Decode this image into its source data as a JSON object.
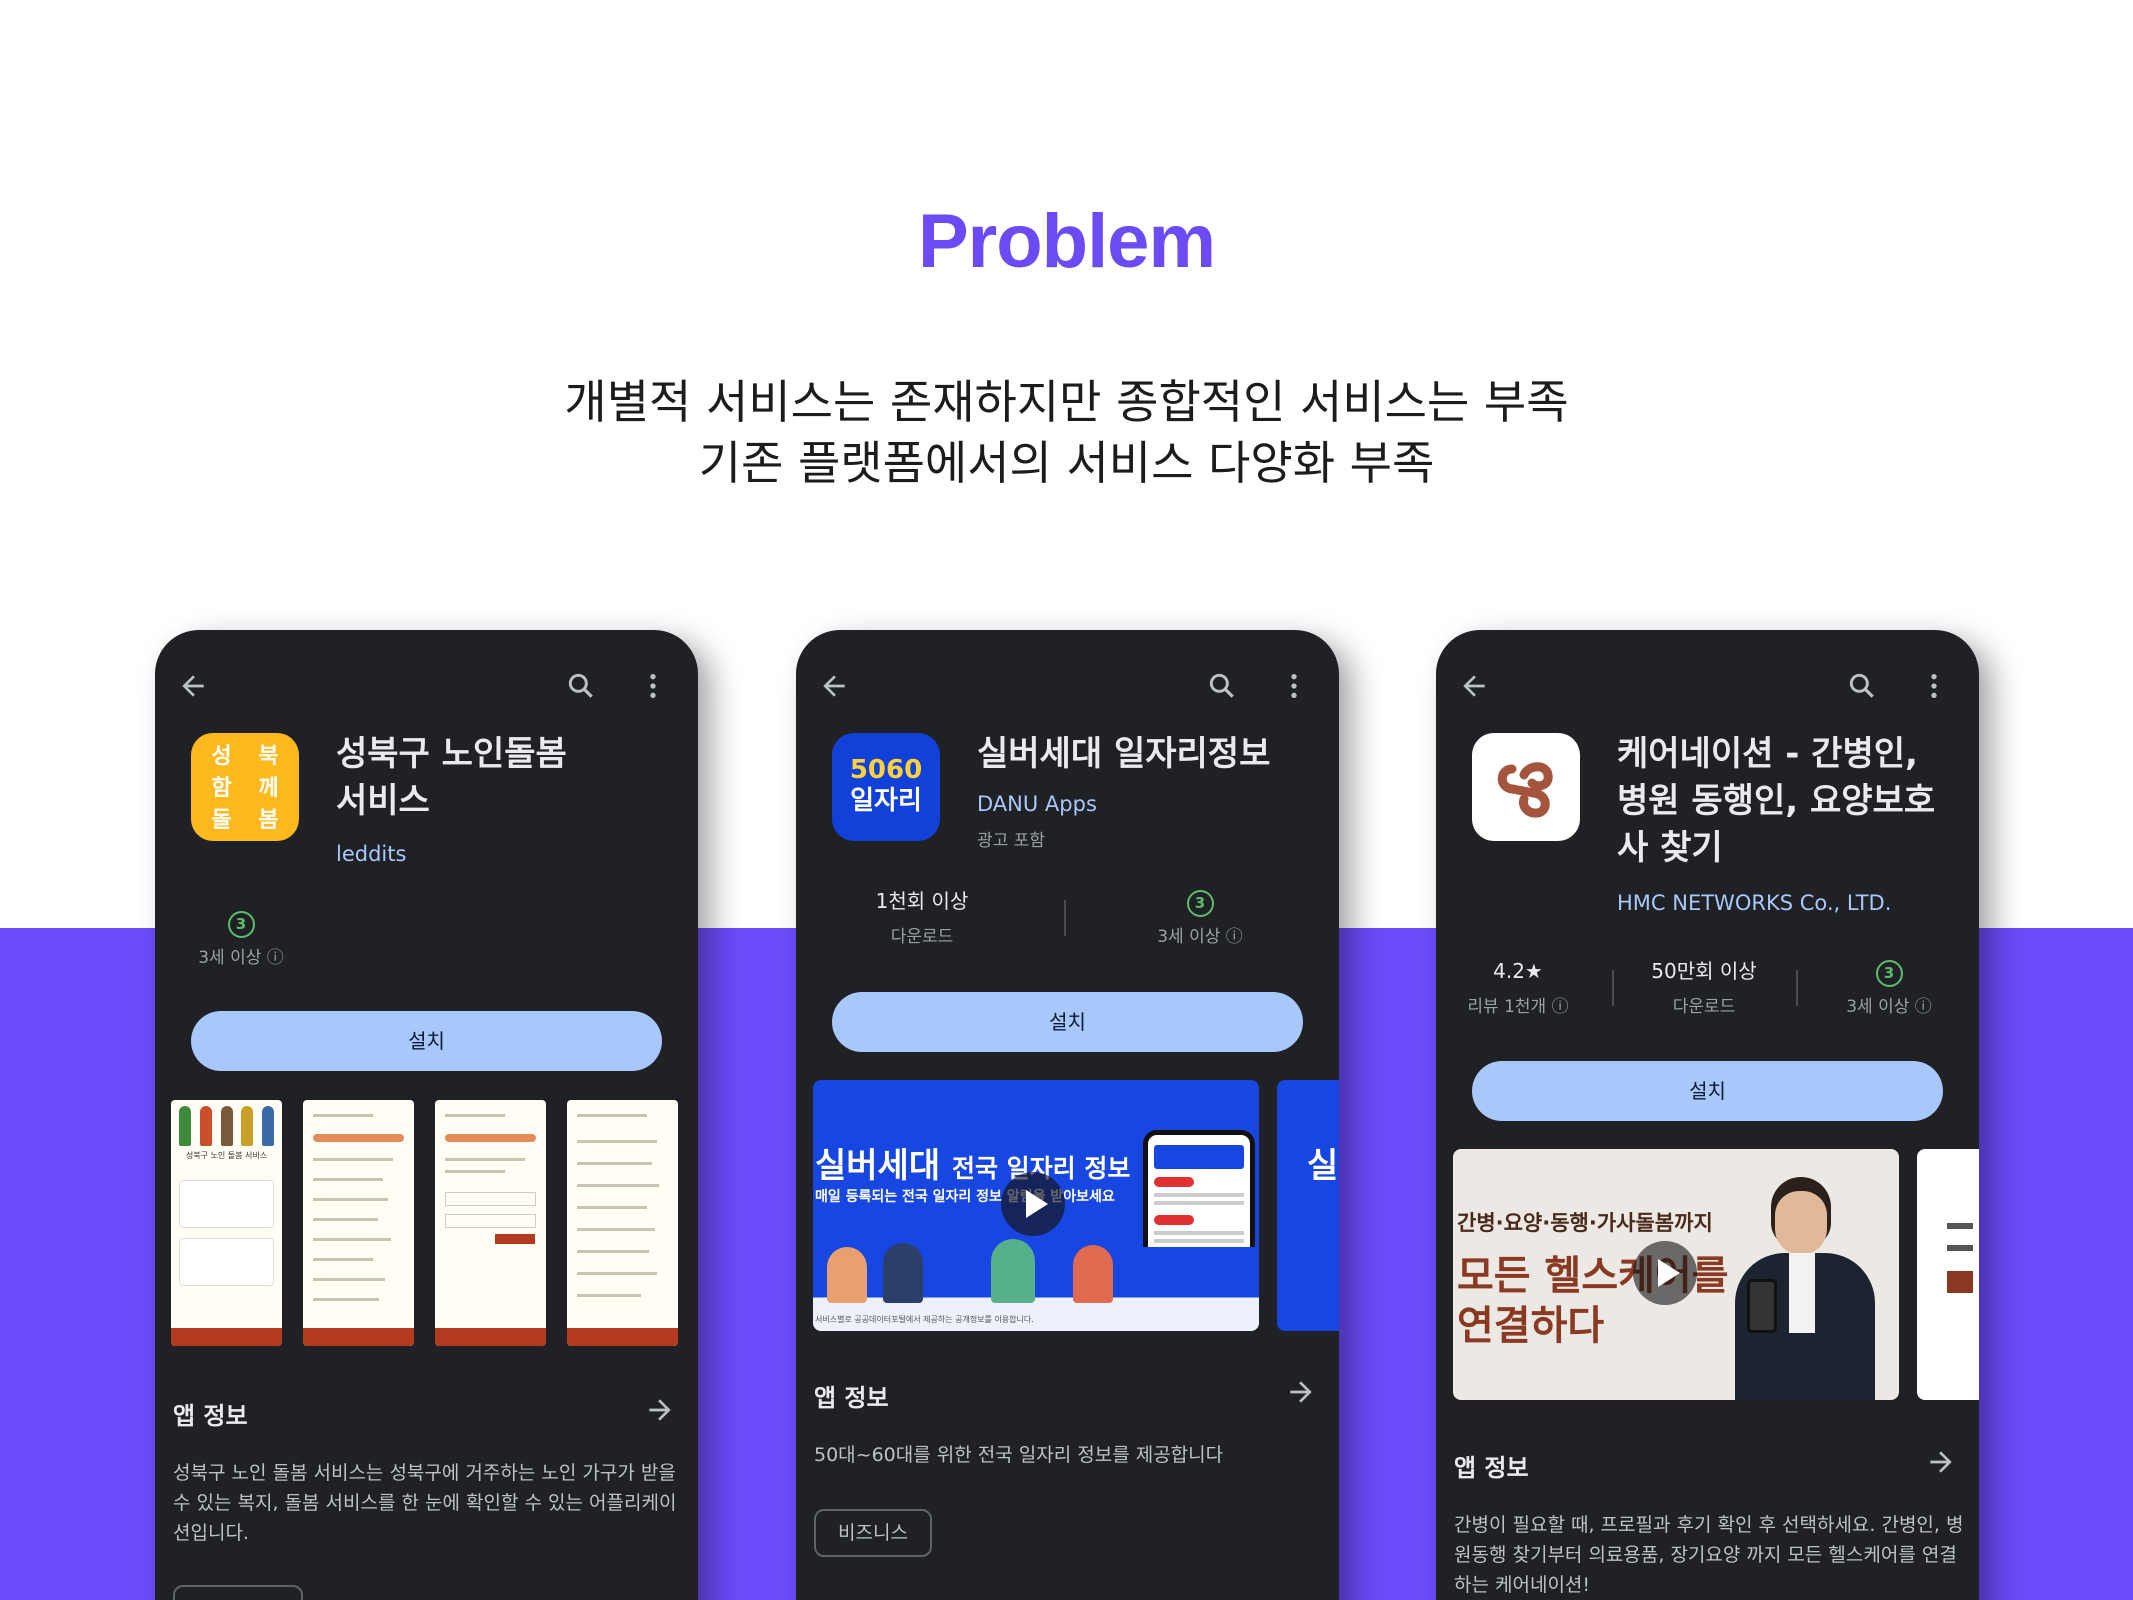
{
  "page": {
    "title": "Problem",
    "subtitle_lines": [
      "개별적 서비스는 존재하지만 종합적인 서비스는 부족",
      "기존 플랫폼에서의 서비스 다양화 부족"
    ],
    "accent": "#6c4bfa"
  },
  "phones": [
    {
      "app_name": "성북구 노인돌봄 서비스",
      "developer": "leddits",
      "icon": {
        "name": "seongbuk-care-icon",
        "glyphs": [
          "성",
          "북",
          "함",
          "께",
          "돌",
          "봄"
        ],
        "bg": "#ffb91e"
      },
      "stats": [
        {
          "value": "3",
          "label": "3세 이상 ⓘ"
        }
      ],
      "install_label": "설치",
      "section_title": "앱 정보",
      "description": "성북구 노인 돌봄 서비스는 성북구에 거주하는 노인 가구가 받을 수 있는 복지, 돌봄 서비스를 한 눈에 확인할 수 있는 어플리케이션입니다.",
      "screenshot_caption": "성북구 노인 돌봄 서비스"
    },
    {
      "app_name": "실버세대 일자리정보",
      "developer": "DANU Apps",
      "ad_note": "광고 포함",
      "icon": {
        "name": "5060-jobs-icon",
        "line1": "5060",
        "line2": "일자리",
        "bg": "#1141d8"
      },
      "stats": [
        {
          "value": "1천회 이상",
          "label": "다운로드"
        },
        {
          "value": "3",
          "label": "3세 이상 ⓘ"
        }
      ],
      "install_label": "설치",
      "banner": {
        "headline": "실버세대",
        "headline2": "전국 일자리 정보",
        "sub": "매일 등록되는 전국 일자리 정보 알림을 받아보세요",
        "footer": "서비스별로 공공데이터포털에서 제공하는 공개정보를 이용합니다."
      },
      "section_title": "앱 정보",
      "description": "50대~60대를 위한 전국 일자리 정보를 제공합니다",
      "category_chip": "비즈니스"
    },
    {
      "app_name": "케어네이션 - 간병인, 병원 동행인, 요양보호사 찾기",
      "developer": "HMC NETWORKS Co., LTD.",
      "icon": {
        "name": "carenation-icon",
        "bg": "#ffffff"
      },
      "stats": [
        {
          "value": "4.2★",
          "label": "리뷰 1천개 ⓘ"
        },
        {
          "value": "50만회 이상",
          "label": "다운로드"
        },
        {
          "value": "3",
          "label": "3세 이상 ⓘ"
        }
      ],
      "install_label": "설치",
      "banner": {
        "line1": "간병·요양·동행·가사돌봄까지",
        "line2": "모든 헬스케어를",
        "line3": "연결하다"
      },
      "section_title": "앱 정보",
      "description": "간병이 필요할 때, 프로필과 후기 확인 후 선택하세요. 간병인, 병원동행 찾기부터 의료용품, 장기요양 까지 모든 헬스케어를 연결하는 케어네이션!"
    }
  ]
}
